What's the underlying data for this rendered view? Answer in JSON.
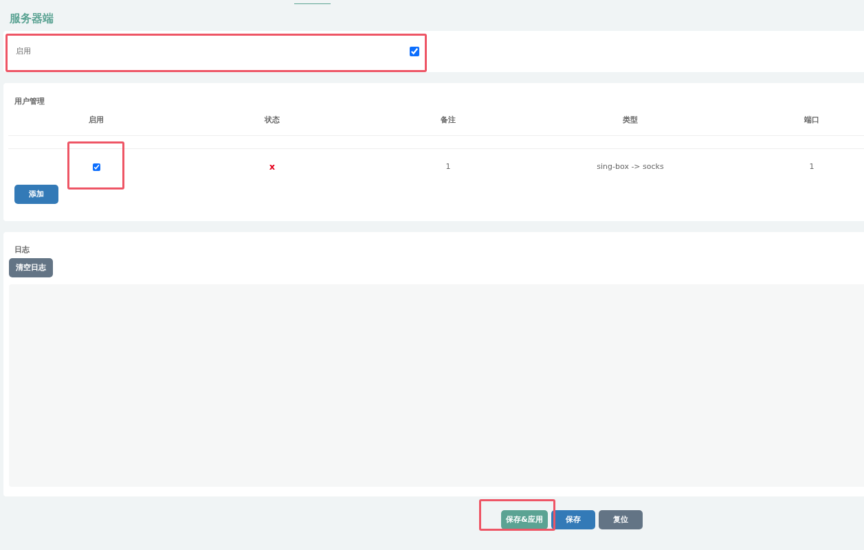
{
  "title": "服务器端",
  "enable_section": {
    "label": "启用",
    "checked": true
  },
  "users": {
    "title": "用户管理",
    "columns": [
      "启用",
      "状态",
      "备注",
      "类型",
      "端口"
    ],
    "rows": [
      {
        "enabled": true,
        "status": "x",
        "remark": "1",
        "type": "sing-box -> socks",
        "port": "1"
      }
    ],
    "add_button": "添加"
  },
  "log": {
    "title": "日志",
    "clear_button": "清空日志"
  },
  "buttons": [
    {
      "kind": "apply",
      "label": "保存&应用"
    },
    {
      "kind": "save",
      "label": "保存"
    },
    {
      "kind": "reset",
      "label": "复位"
    }
  ]
}
